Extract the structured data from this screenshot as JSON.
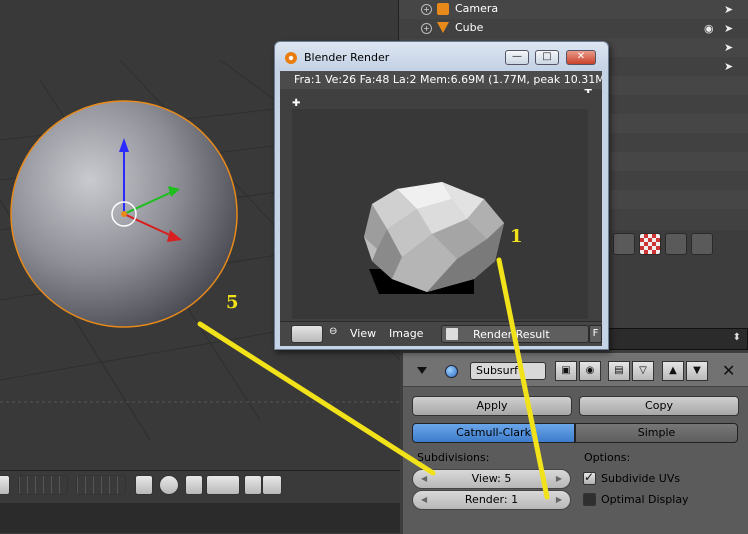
{
  "outliner": {
    "items": [
      {
        "label": "Camera",
        "icon": "camera-icon"
      },
      {
        "label": "Cube",
        "icon": "mesh-icon"
      }
    ]
  },
  "render_window": {
    "title": "Blender Render",
    "info": "Fra:1  Ve:26 Fa:48 La:2 Mem:6.69M (1.77M, peak 10.31M)",
    "footer": {
      "view_label": "View",
      "image_label": "Image",
      "result_label": "Render Result",
      "f_label": "F"
    }
  },
  "modifier": {
    "name": "Subsurf",
    "apply_label": "Apply",
    "copy_label": "Copy",
    "modes": [
      "Catmull-Clark",
      "Simple"
    ],
    "active_mode": "Catmull-Clark",
    "subdivisions_label": "Subdivisions:",
    "view_field": "View: 5",
    "render_field": "Render: 1",
    "view_value": 5,
    "render_value": 1,
    "options_label": "Options:",
    "subdivide_uvs_label": "Subdivide UVs",
    "subdivide_uvs_checked": true,
    "optimal_display_label": "Optimal Display",
    "optimal_display_checked": false
  },
  "annotations": {
    "label_1": "1",
    "label_5": "5",
    "color": "#f1e21a"
  },
  "colors": {
    "accent_blue": "#4d8cdb",
    "selection_orange": "#e88a1a"
  }
}
